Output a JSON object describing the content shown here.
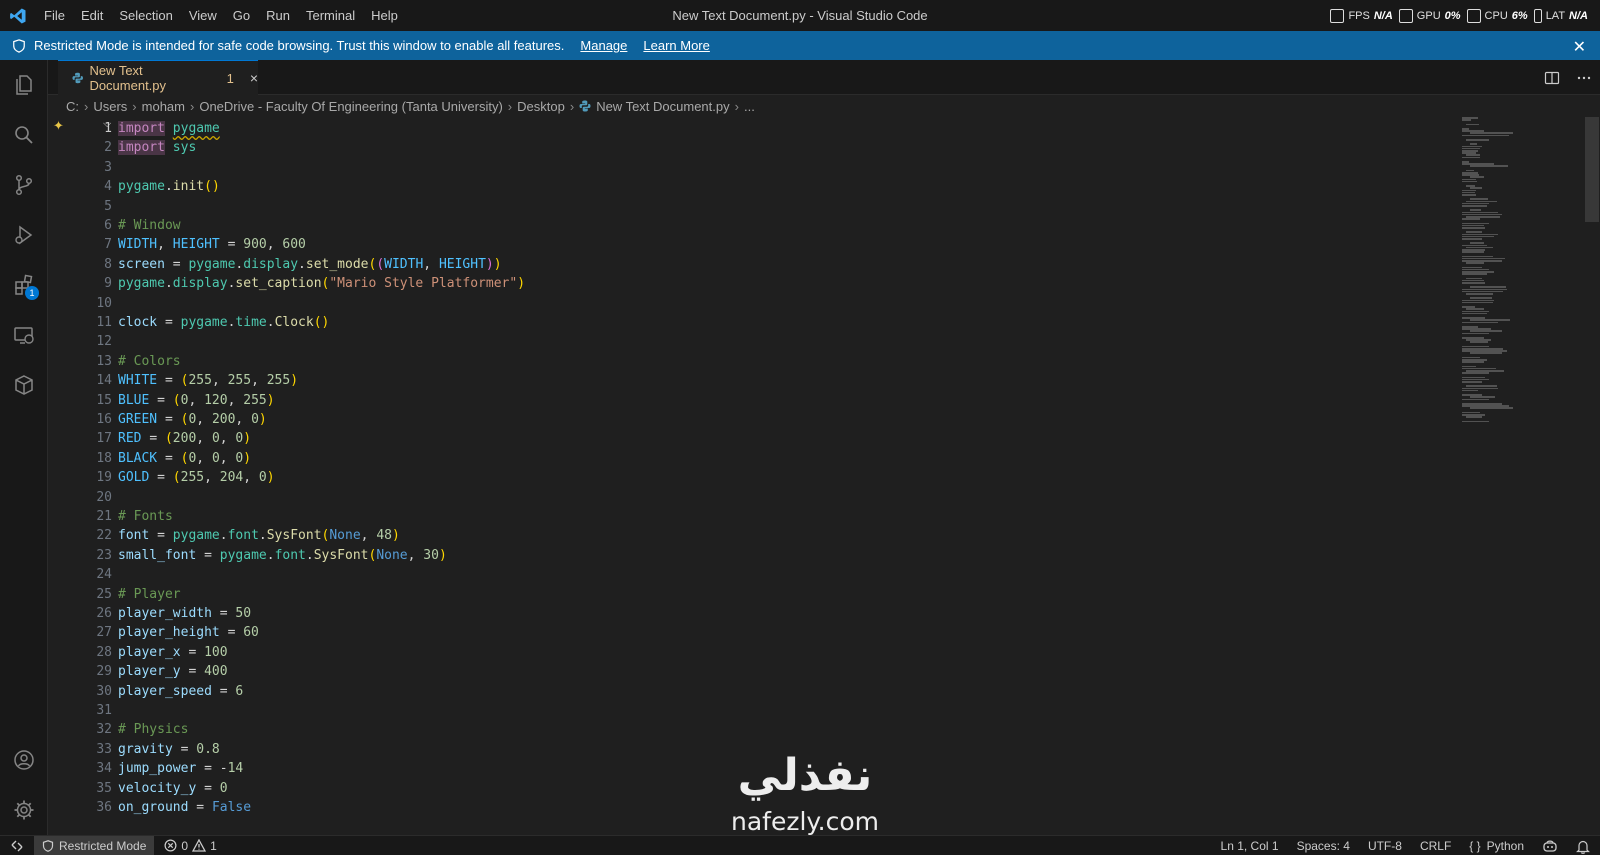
{
  "titlebar": {
    "menus": [
      "File",
      "Edit",
      "Selection",
      "View",
      "Go",
      "Run",
      "Terminal",
      "Help"
    ],
    "title": "New Text Document.py - Visual Studio Code",
    "overlay": {
      "fps_label": "FPS",
      "fps_value": "N/A",
      "gpu_label": "GPU",
      "gpu_value": "0%",
      "cpu_label": "CPU",
      "cpu_value": "6%",
      "lat_label": "LAT",
      "lat_value": "N/A"
    }
  },
  "banner": {
    "message": "Restricted Mode is intended for safe code browsing. Trust this window to enable all features.",
    "manage": "Manage",
    "learn_more": "Learn More",
    "close": "✕"
  },
  "activitybar": {
    "items": [
      "files-icon",
      "search-icon",
      "source-control-icon",
      "run-debug-icon",
      "extensions-icon",
      "remote-explorer-icon",
      "package-icon"
    ],
    "extensions_badge": "1",
    "bottom": [
      "account-icon",
      "manage-gear-icon"
    ]
  },
  "tab": {
    "label": "New Text Document.py",
    "problems": "1",
    "close": "×"
  },
  "breadcrumb": [
    "C:",
    "Users",
    "moham",
    "OneDrive - Faculty Of Engineering (Tanta University)",
    "Desktop",
    "New Text Document.py",
    "..."
  ],
  "editor": {
    "current_line": 1,
    "line_numbers": [
      "1",
      "2",
      "3",
      "4",
      "5",
      "6",
      "7",
      "8",
      "9",
      "10",
      "11",
      "12",
      "13",
      "14",
      "15",
      "16",
      "17",
      "18",
      "19",
      "20",
      "21",
      "22",
      "23",
      "24",
      "25",
      "26",
      "27",
      "28",
      "29",
      "30",
      "31",
      "32",
      "33",
      "34",
      "35",
      "36"
    ],
    "lines": [
      "import pygame",
      "import sys",
      "",
      "pygame.init()",
      "",
      "# Window",
      "WIDTH, HEIGHT = 900, 600",
      "screen = pygame.display.set_mode((WIDTH, HEIGHT))",
      "pygame.display.set_caption(\"Mario Style Platformer\")",
      "",
      "clock = pygame.time.Clock()",
      "",
      "# Colors",
      "WHITE = (255, 255, 255)",
      "BLUE = (0, 120, 255)",
      "GREEN = (0, 200, 0)",
      "RED = (200, 0, 0)",
      "BLACK = (0, 0, 0)",
      "GOLD = (255, 204, 0)",
      "",
      "# Fonts",
      "font = pygame.font.SysFont(None, 48)",
      "small_font = pygame.font.SysFont(None, 30)",
      "",
      "# Player",
      "player_width = 50",
      "player_height = 60",
      "player_x = 100",
      "player_y = 400",
      "player_speed = 6",
      "",
      "# Physics",
      "gravity = 0.8",
      "jump_power = -14",
      "velocity_y = 0",
      "on_ground = False"
    ]
  },
  "watermark": {
    "arabic": "نفذلي",
    "latin": "nafezly.com"
  },
  "statusbar": {
    "restricted": "Restricted Mode",
    "errors": "0",
    "warnings": "1",
    "position": "Ln 1, Col 1",
    "spaces": "Spaces: 4",
    "encoding": "UTF-8",
    "eol": "CRLF",
    "language": "Python"
  }
}
